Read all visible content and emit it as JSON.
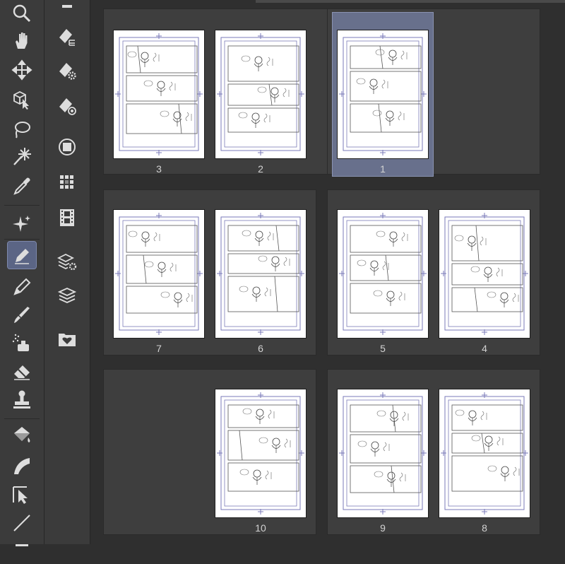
{
  "toolbar": {
    "tools": [
      {
        "name": "zoom-tool",
        "icon": "magnifier-icon"
      },
      {
        "name": "hand-tool",
        "icon": "hand-icon"
      },
      {
        "name": "move-tool",
        "icon": "move-arrows-icon"
      },
      {
        "name": "operation-tool",
        "icon": "cube-cursor-icon"
      },
      {
        "name": "lasso-tool",
        "icon": "lasso-icon"
      },
      {
        "name": "magic-wand-tool",
        "icon": "magic-wand-icon"
      },
      {
        "name": "eyedropper-tool",
        "icon": "eyedropper-icon"
      },
      {
        "name": "sparkle-tool",
        "icon": "sparkle-icon"
      },
      {
        "name": "pen-tool",
        "icon": "pen-icon",
        "active": true
      },
      {
        "name": "pencil-tool",
        "icon": "pencil-icon"
      },
      {
        "name": "brush-tool",
        "icon": "brush-icon"
      },
      {
        "name": "airbrush-tool",
        "icon": "airbrush-icon"
      },
      {
        "name": "eraser-tool",
        "icon": "eraser-icon"
      },
      {
        "name": "stamp-tool",
        "icon": "stamp-icon"
      },
      {
        "name": "fill-tool",
        "icon": "fill-bucket-icon"
      },
      {
        "name": "gradient-tool",
        "icon": "gradient-icon"
      },
      {
        "name": "frame-tool",
        "icon": "frame-cursor-icon"
      },
      {
        "name": "line-tool",
        "icon": "line-icon"
      }
    ],
    "active_color": "#5b6585"
  },
  "command_bar": {
    "commands": [
      {
        "name": "cmd-page-export",
        "icon": "page-tree-icon"
      },
      {
        "name": "cmd-page-settings",
        "icon": "page-gear-icon"
      },
      {
        "name": "cmd-page-target",
        "icon": "page-target-icon"
      },
      {
        "name": "cmd-shape",
        "icon": "circle-square-icon"
      },
      {
        "name": "cmd-tone",
        "icon": "grid-icon"
      },
      {
        "name": "cmd-timeline",
        "icon": "film-icon"
      },
      {
        "name": "cmd-layer-properties",
        "icon": "layers-gear-icon"
      },
      {
        "name": "cmd-layers",
        "icon": "layers-icon"
      },
      {
        "name": "cmd-favorites",
        "icon": "folder-heart-icon"
      }
    ]
  },
  "pages": [
    {
      "number": "3"
    },
    {
      "number": "2"
    },
    {
      "number": "1",
      "selected": true
    },
    {
      "number": "7"
    },
    {
      "number": "6"
    },
    {
      "number": "5"
    },
    {
      "number": "4"
    },
    {
      "number": "10"
    },
    {
      "number": "9"
    },
    {
      "number": "8"
    }
  ],
  "colors": {
    "background": "#2f2f2f",
    "panel": "#3e3e3e",
    "selected": "#68708c",
    "guide": "#7a7ab8"
  }
}
